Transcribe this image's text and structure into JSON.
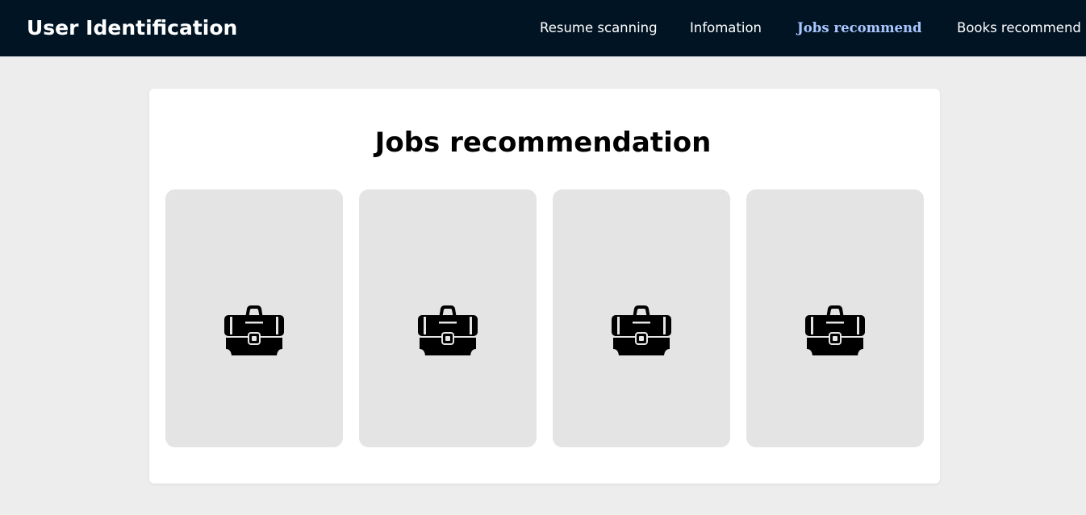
{
  "header": {
    "brand": "User Identification",
    "nav": [
      {
        "label": "Resume scanning",
        "active": false
      },
      {
        "label": "Infomation",
        "active": false
      },
      {
        "label": "Jobs recommend",
        "active": true
      },
      {
        "label": "Books recommend",
        "active": false
      }
    ]
  },
  "main": {
    "title": "Jobs recommendation",
    "cards": [
      {
        "icon": "briefcase-icon"
      },
      {
        "icon": "briefcase-icon"
      },
      {
        "icon": "briefcase-icon"
      },
      {
        "icon": "briefcase-icon"
      }
    ]
  },
  "colors": {
    "header_bg": "#011424",
    "active_nav": "#a9c7ff",
    "page_bg": "#ededed",
    "card_bg": "#e4e4e4"
  }
}
